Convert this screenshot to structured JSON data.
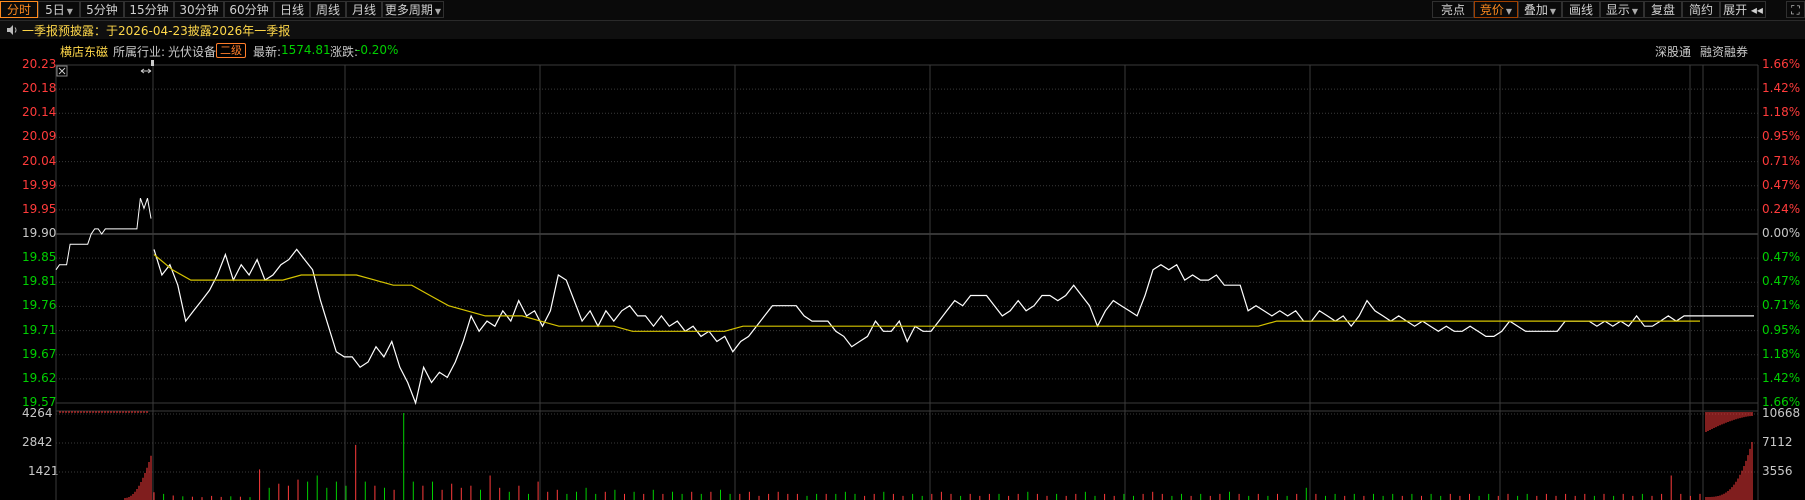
{
  "toolbar": {
    "left_tabs": [
      {
        "label": "分时",
        "active": true
      },
      {
        "label": "5日",
        "dropdown": true
      },
      {
        "label": "5分钟"
      },
      {
        "label": "15分钟"
      },
      {
        "label": "30分钟"
      },
      {
        "label": "60分钟"
      },
      {
        "label": "日线"
      },
      {
        "label": "周线"
      },
      {
        "label": "月线"
      },
      {
        "label": "更多周期",
        "dropdown": true
      }
    ],
    "right_buttons": [
      {
        "label": "亮点"
      },
      {
        "label": "竞价",
        "active": true,
        "dropdown": true
      },
      {
        "label": "叠加",
        "dropdown": true
      },
      {
        "label": "画线"
      },
      {
        "label": "显示",
        "dropdown": true
      },
      {
        "label": "复盘"
      },
      {
        "label": "简约"
      },
      {
        "label": "展开 ◂◂"
      }
    ],
    "icons": [
      "speaker-icon",
      "fullscreen-icon"
    ]
  },
  "notice": {
    "text": "一季报预披露：于2026-04-23披露2026年一季报"
  },
  "stock_info": {
    "name": "横店东磁",
    "industry_label": "所属行业:",
    "industry": "光伏设备",
    "tier": "二级",
    "latest_label": "最新:",
    "latest": "1574.81",
    "change_label": "涨跌:",
    "change": "-0.20%",
    "link1": "深股通",
    "link2": "融资融券"
  },
  "colors": {
    "up": "#ff3b3b",
    "down": "#00d000",
    "price_line": "#ffffff",
    "avg_line": "#d6c400",
    "grid": "#3a3a3a",
    "accent": "#ff8a1e",
    "notice": "#ffd84a"
  },
  "chart_data": {
    "type": "line",
    "title": "",
    "price_axis_left": [
      "20.23",
      "20.18",
      "20.14",
      "20.09",
      "20.04",
      "19.99",
      "19.95",
      "19.90",
      "19.85",
      "19.81",
      "19.76",
      "19.71",
      "19.67",
      "19.62",
      "19.57"
    ],
    "pct_axis_right": [
      "1.66%",
      "1.42%",
      "1.18%",
      "0.95%",
      "0.71%",
      "0.47%",
      "0.24%",
      "0.00%",
      "0.47%",
      "0.47%",
      "0.71%",
      "0.95%",
      "1.18%",
      "1.42%",
      "1.66%"
    ],
    "prev_close": 19.9,
    "ylim": [
      19.57,
      20.23
    ],
    "auction_series": [
      19.83,
      19.84,
      19.84,
      19.84,
      19.88,
      19.88,
      19.88,
      19.88,
      19.88,
      19.88,
      19.9,
      19.91,
      19.91,
      19.9,
      19.91,
      19.91,
      19.91,
      19.91,
      19.91,
      19.91,
      19.91,
      19.91,
      19.91,
      19.91,
      19.97,
      19.95,
      19.97,
      19.93
    ],
    "price_series": [
      19.87,
      19.82,
      19.84,
      19.8,
      19.73,
      19.75,
      19.77,
      19.79,
      19.82,
      19.86,
      19.81,
      19.84,
      19.82,
      19.85,
      19.81,
      19.82,
      19.84,
      19.85,
      19.87,
      19.85,
      19.83,
      19.77,
      19.72,
      19.67,
      19.66,
      19.66,
      19.64,
      19.65,
      19.68,
      19.66,
      19.69,
      19.64,
      19.61,
      19.57,
      19.64,
      19.61,
      19.63,
      19.62,
      19.65,
      19.69,
      19.74,
      19.71,
      19.73,
      19.72,
      19.75,
      19.73,
      19.77,
      19.74,
      19.75,
      19.72,
      19.75,
      19.82,
      19.81,
      19.77,
      19.73,
      19.75,
      19.72,
      19.75,
      19.73,
      19.75,
      19.76,
      19.74,
      19.74,
      19.72,
      19.74,
      19.72,
      19.73,
      19.71,
      19.72,
      19.7,
      19.71,
      19.69,
      19.7,
      19.67,
      19.69,
      19.7,
      19.72,
      19.74,
      19.76,
      19.76,
      19.76,
      19.76,
      19.74,
      19.73,
      19.73,
      19.73,
      19.71,
      19.7,
      19.68,
      19.69,
      19.7,
      19.73,
      19.71,
      19.71,
      19.73,
      19.69,
      19.72,
      19.71,
      19.71,
      19.73,
      19.75,
      19.77,
      19.76,
      19.78,
      19.78,
      19.78,
      19.76,
      19.74,
      19.75,
      19.77,
      19.75,
      19.76,
      19.78,
      19.78,
      19.77,
      19.78,
      19.8,
      19.78,
      19.76,
      19.72,
      19.75,
      19.77,
      19.76,
      19.75,
      19.74,
      19.78,
      19.83,
      19.84,
      19.83,
      19.84,
      19.81,
      19.82,
      19.81,
      19.81,
      19.82,
      19.8,
      19.8,
      19.8,
      19.75,
      19.76,
      19.75,
      19.74,
      19.75,
      19.74,
      19.75,
      19.73,
      19.73,
      19.75,
      19.74,
      19.73,
      19.74,
      19.72,
      19.74,
      19.77,
      19.75,
      19.74,
      19.73,
      19.74,
      19.73,
      19.72,
      19.73,
      19.72,
      19.71,
      19.72,
      19.71,
      19.71,
      19.72,
      19.71,
      19.7,
      19.7,
      19.71,
      19.73,
      19.72,
      19.71,
      19.71,
      19.71,
      19.71,
      19.71,
      19.73,
      19.73,
      19.73,
      19.73,
      19.72,
      19.73,
      19.72,
      19.73,
      19.72,
      19.74,
      19.72,
      19.72,
      19.73,
      19.74,
      19.73,
      19.74,
      19.74,
      19.74
    ],
    "avg_series": [
      19.86,
      19.83,
      19.81,
      19.81,
      19.81,
      19.81,
      19.81,
      19.81,
      19.82,
      19.82,
      19.82,
      19.82,
      19.81,
      19.8,
      19.8,
      19.78,
      19.76,
      19.75,
      19.74,
      19.74,
      19.74,
      19.73,
      19.72,
      19.72,
      19.72,
      19.72,
      19.71,
      19.71,
      19.71,
      19.71,
      19.71,
      19.71,
      19.72,
      19.72,
      19.72,
      19.72,
      19.72,
      19.72,
      19.72,
      19.72,
      19.72,
      19.72,
      19.72,
      19.72,
      19.72,
      19.72,
      19.72,
      19.72,
      19.72,
      19.72,
      19.72,
      19.72,
      19.72,
      19.72,
      19.72,
      19.72,
      19.72,
      19.72,
      19.72,
      19.72,
      19.72,
      19.73,
      19.73,
      19.73,
      19.73,
      19.73,
      19.73,
      19.73,
      19.73,
      19.73,
      19.73,
      19.73,
      19.73,
      19.73,
      19.73,
      19.73,
      19.73,
      19.73,
      19.73,
      19.73,
      19.73,
      19.73,
      19.73,
      19.73,
      19.73
    ],
    "volume_axis_left": [
      "4264",
      "2842",
      "1421"
    ],
    "volume_axis_right": [
      "10668",
      "7112",
      "3556"
    ],
    "vol_max": 4264,
    "auction_vol_max": 10668,
    "volume_series": [
      380,
      300,
      220,
      180,
      160,
      140,
      200,
      150,
      180,
      160,
      140,
      1500,
      600,
      800,
      700,
      1000,
      900,
      1200,
      600,
      900,
      700,
      2700,
      900,
      700,
      600,
      500,
      4264,
      900,
      700,
      900,
      500,
      800,
      600,
      700,
      500,
      1200,
      600,
      400,
      700,
      300,
      900,
      400,
      500,
      300,
      400,
      600,
      300,
      400,
      500,
      300,
      400,
      300,
      500,
      300,
      400,
      300,
      400,
      300,
      400,
      500,
      300,
      300,
      400,
      200,
      300,
      400,
      300,
      300,
      200,
      300,
      300,
      300,
      400,
      300,
      200,
      300,
      400,
      300,
      200,
      300,
      200,
      300,
      400,
      300,
      200,
      300,
      200,
      300,
      300,
      200,
      300,
      400,
      300,
      200,
      300,
      200,
      300,
      400,
      200,
      300,
      200,
      300,
      200,
      300,
      400,
      300,
      200,
      300,
      200,
      300,
      200,
      300,
      400,
      300,
      200,
      300,
      200,
      300,
      200,
      300,
      600,
      300,
      200,
      300,
      200,
      300,
      200,
      300,
      200,
      300,
      200,
      300,
      200,
      300,
      200,
      300,
      200,
      300,
      200,
      300,
      200,
      300,
      200,
      300,
      200,
      300,
      200,
      300,
      200,
      300,
      200,
      300,
      200,
      300,
      200,
      300,
      200,
      300,
      1200,
      300,
      200,
      300
    ],
    "grid": true
  }
}
